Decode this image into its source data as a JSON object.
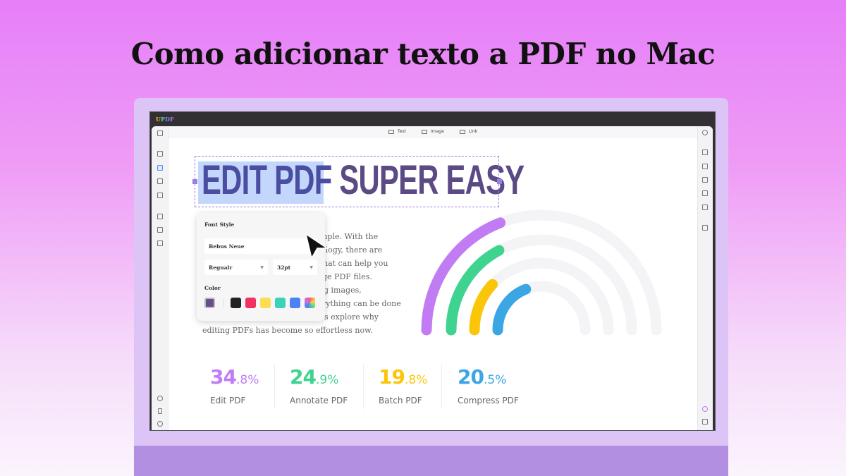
{
  "title": "Como adicionar texto a PDF no Mac",
  "app": {
    "logo": [
      "U",
      "P",
      "D",
      "F"
    ]
  },
  "toolbar": {
    "text": "Text",
    "image": "Image",
    "link": "Link"
  },
  "headline": {
    "selected": "EDIT PDF",
    "rest": " SUPER EASY"
  },
  "body_fragments": [
    "mple. With the",
    "ology, there are",
    "hat can help you",
    "ge PDF files.",
    "g images,",
    "rything can be done",
    "s explore why",
    "editing PDFs has become so effortless now."
  ],
  "font_popup": {
    "title": "Font Style",
    "font": "Bebus Neue",
    "weight": "Regualr",
    "size": "32pt",
    "color_label": "Color",
    "current_color": "#6a4d8c",
    "swatches": [
      "#222222",
      "#f2315e",
      "#fbdc52",
      "#3bd2bb",
      "#4d82f2",
      "gradient"
    ]
  },
  "stats": [
    {
      "int": "34",
      "dec": ".8%",
      "label": "Edit PDF",
      "color": "#c17cf3"
    },
    {
      "int": "24",
      "dec": ".9%",
      "label": "Annotate PDF",
      "color": "#3ed38e"
    },
    {
      "int": "19",
      "dec": ".8%",
      "label": "Batch PDF",
      "color": "#fbc60a"
    },
    {
      "int": "20",
      "dec": ".5%",
      "label": "Compress PDF",
      "color": "#3aa6e4"
    }
  ]
}
